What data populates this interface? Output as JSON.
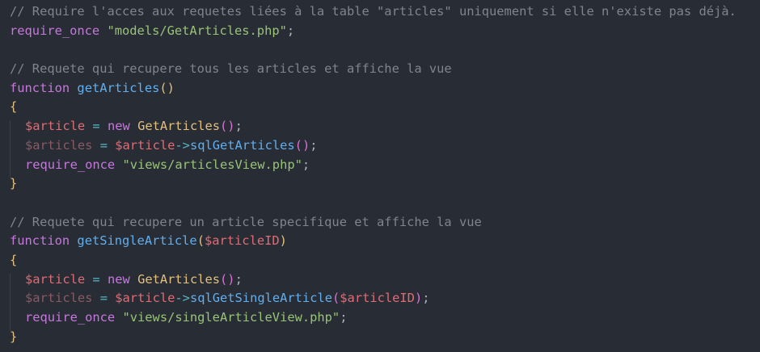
{
  "editor": {
    "lines": [
      [
        {
          "t": "comment",
          "v": "// Require l'acces aux requetes liées à la table \"articles\" uniquement si elle n'existe pas déjà."
        }
      ],
      [
        {
          "t": "keyword",
          "v": "require_once"
        },
        {
          "t": "plain",
          "v": " "
        },
        {
          "t": "string",
          "v": "\"models/GetArticles.php\""
        },
        {
          "t": "plain",
          "v": ";"
        }
      ],
      [],
      [
        {
          "t": "comment",
          "v": "// Requete qui recupere tous les articles et affiche la vue"
        }
      ],
      [
        {
          "t": "keyword",
          "v": "function"
        },
        {
          "t": "plain",
          "v": " "
        },
        {
          "t": "func",
          "v": "getArticles"
        },
        {
          "t": "paren",
          "v": "()"
        }
      ],
      [
        {
          "t": "brace",
          "v": "{"
        }
      ],
      [
        {
          "t": "indent"
        },
        {
          "t": "var",
          "v": "$article"
        },
        {
          "t": "plain",
          "v": " "
        },
        {
          "t": "op",
          "v": "="
        },
        {
          "t": "plain",
          "v": " "
        },
        {
          "t": "keyword",
          "v": "new"
        },
        {
          "t": "plain",
          "v": " "
        },
        {
          "t": "class",
          "v": "GetArticles"
        },
        {
          "t": "paren2",
          "v": "()"
        },
        {
          "t": "plain",
          "v": ";"
        }
      ],
      [
        {
          "t": "indent"
        },
        {
          "t": "var-dim",
          "v": "$articles"
        },
        {
          "t": "plain",
          "v": " "
        },
        {
          "t": "op",
          "v": "="
        },
        {
          "t": "plain",
          "v": " "
        },
        {
          "t": "var",
          "v": "$article"
        },
        {
          "t": "op",
          "v": "->"
        },
        {
          "t": "func",
          "v": "sqlGetArticles"
        },
        {
          "t": "paren2",
          "v": "()"
        },
        {
          "t": "plain",
          "v": ";"
        }
      ],
      [
        {
          "t": "indent"
        },
        {
          "t": "keyword",
          "v": "require_once"
        },
        {
          "t": "plain",
          "v": " "
        },
        {
          "t": "string",
          "v": "\"views/articlesView.php\""
        },
        {
          "t": "plain",
          "v": ";"
        }
      ],
      [
        {
          "t": "brace",
          "v": "}"
        }
      ],
      [],
      [
        {
          "t": "comment",
          "v": "// Requete qui recupere un article specifique et affiche la vue"
        }
      ],
      [
        {
          "t": "keyword",
          "v": "function"
        },
        {
          "t": "plain",
          "v": " "
        },
        {
          "t": "func",
          "v": "getSingleArticle"
        },
        {
          "t": "paren",
          "v": "("
        },
        {
          "t": "var",
          "v": "$articleID"
        },
        {
          "t": "paren",
          "v": ")"
        }
      ],
      [
        {
          "t": "brace",
          "v": "{"
        }
      ],
      [
        {
          "t": "indent"
        },
        {
          "t": "var",
          "v": "$article"
        },
        {
          "t": "plain",
          "v": " "
        },
        {
          "t": "op",
          "v": "="
        },
        {
          "t": "plain",
          "v": " "
        },
        {
          "t": "keyword",
          "v": "new"
        },
        {
          "t": "plain",
          "v": " "
        },
        {
          "t": "class",
          "v": "GetArticles"
        },
        {
          "t": "paren2",
          "v": "()"
        },
        {
          "t": "plain",
          "v": ";"
        }
      ],
      [
        {
          "t": "indent"
        },
        {
          "t": "var-dim",
          "v": "$articles"
        },
        {
          "t": "plain",
          "v": " "
        },
        {
          "t": "op",
          "v": "="
        },
        {
          "t": "plain",
          "v": " "
        },
        {
          "t": "var",
          "v": "$article"
        },
        {
          "t": "op",
          "v": "->"
        },
        {
          "t": "func",
          "v": "sqlGetSingleArticle"
        },
        {
          "t": "paren2",
          "v": "("
        },
        {
          "t": "var",
          "v": "$articleID"
        },
        {
          "t": "paren2",
          "v": ")"
        },
        {
          "t": "plain",
          "v": ";"
        }
      ],
      [
        {
          "t": "indent"
        },
        {
          "t": "keyword",
          "v": "require_once"
        },
        {
          "t": "plain",
          "v": " "
        },
        {
          "t": "string",
          "v": "\"views/singleArticleView.php\""
        },
        {
          "t": "plain",
          "v": ";"
        }
      ],
      [
        {
          "t": "brace",
          "v": "}"
        }
      ]
    ]
  },
  "colors": {
    "background": "#282c34",
    "comment": "#7f848e",
    "keyword": "#c678dd",
    "string": "#98c379",
    "function": "#61afef",
    "class": "#e5c07b",
    "variable": "#e06c75"
  }
}
